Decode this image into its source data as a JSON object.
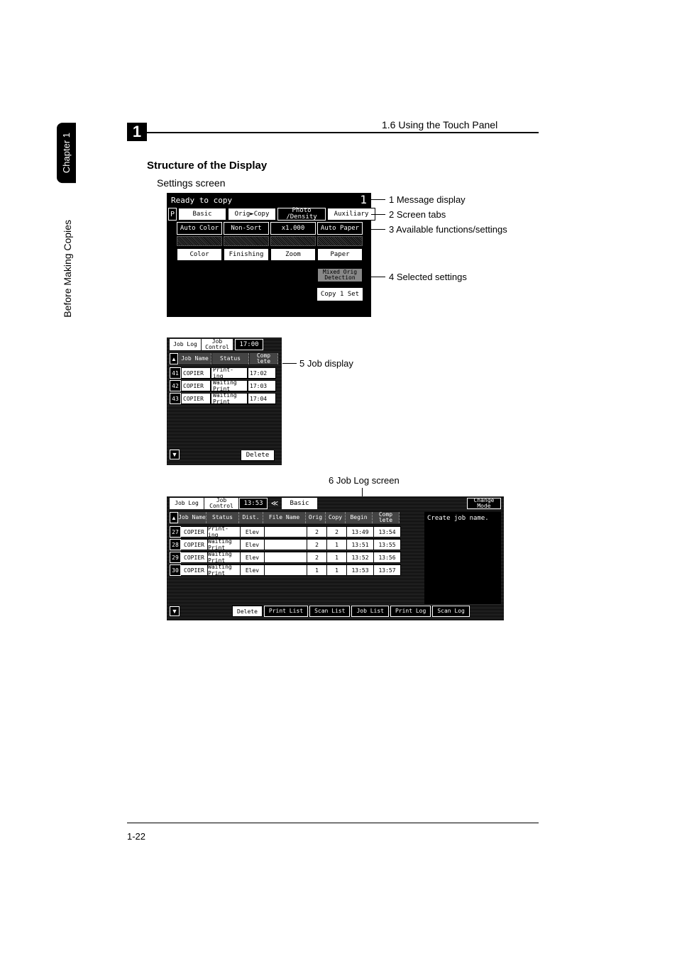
{
  "header": {
    "section": "1",
    "breadcrumb": "1.6 Using the Touch Panel"
  },
  "sidebar": {
    "chapter": "Chapter 1",
    "label": "Before Making Copies"
  },
  "page": {
    "heading": "Structure of the Display",
    "sub": "Settings screen",
    "footer": "1-22"
  },
  "callouts": {
    "c1": "1 Message display",
    "c2": "2 Screen tabs",
    "c3": "3 Available functions/settings",
    "c4": "4 Selected settings",
    "c5": "5 Job display",
    "c6": "6 Job Log screen"
  },
  "settings": {
    "msg": "Ready to copy",
    "copies": "1",
    "tabs": [
      "Basic",
      "Orig►Copy",
      "Photo /Density",
      "Auxiliary"
    ],
    "funcs": [
      "Auto Color",
      "Non-Sort",
      "x1.000",
      "Auto Paper"
    ],
    "row4": [
      "Color",
      "Finishing",
      "Zoom",
      "Paper"
    ],
    "sel1": "Mixed Orig Detection",
    "sel2": "Copy 1 Set"
  },
  "jobSmall": {
    "tabs": [
      "Job Log",
      "Job Control"
    ],
    "time": "17:00",
    "hdr": [
      "Job Name",
      "Status",
      "Comp lete"
    ],
    "rows": [
      {
        "idx": "41",
        "name": "COPIER",
        "status": "Print- ing",
        "time": "17:02"
      },
      {
        "idx": "42",
        "name": "COPIER",
        "status": "Waiting Print",
        "time": "17:03"
      },
      {
        "idx": "43",
        "name": "COPIER",
        "status": "Waiting Print",
        "time": "17:04"
      }
    ],
    "delete": "Delete"
  },
  "jobLog": {
    "tabs": [
      "Job Log",
      "Job Control"
    ],
    "time": "13:53",
    "basic": "Basic",
    "change": "Change Mode",
    "hdr": [
      "Job Name",
      "Status",
      "Dist.",
      "File Name",
      "Orig",
      "Copy",
      "Begin",
      "Comp lete"
    ],
    "sideMsg": "Create job name.",
    "rows": [
      {
        "idx": "27",
        "name": "COPIER",
        "status": "Print- ing",
        "dist": "Elev",
        "file": "",
        "orig": "2",
        "copy": "2",
        "begin": "13:49",
        "comp": "13:54"
      },
      {
        "idx": "28",
        "name": "COPIER",
        "status": "Waiting Print",
        "dist": "Elev",
        "file": "",
        "orig": "2",
        "copy": "1",
        "begin": "13:51",
        "comp": "13:55"
      },
      {
        "idx": "29",
        "name": "COPIER",
        "status": "Waiting Print",
        "dist": "Elev",
        "file": "",
        "orig": "2",
        "copy": "1",
        "begin": "13:52",
        "comp": "13:56"
      },
      {
        "idx": "30",
        "name": "COPIER",
        "status": "Waiting Print",
        "dist": "Elev",
        "file": "",
        "orig": "1",
        "copy": "1",
        "begin": "13:53",
        "comp": "13:57"
      }
    ],
    "bottom": {
      "delete": "Delete",
      "printList": "Print List",
      "scanList": "Scan List",
      "jobList": "Job List",
      "printLog": "Print Log",
      "scanLog": "Scan Log"
    }
  }
}
